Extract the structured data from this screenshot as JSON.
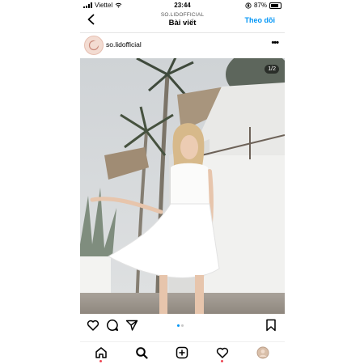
{
  "status": {
    "carrier": "Viettel",
    "time": "23:44",
    "battery": "87%"
  },
  "header": {
    "subtitle": "SO.LIDOFFICIAL",
    "title": "Bài viết",
    "follow_label": "Theo dõi"
  },
  "post": {
    "username": "so.lidofficial",
    "counter": "1/2",
    "more_label": "•••"
  },
  "pager": {
    "current": 1,
    "total": 2
  },
  "colors": {
    "accent": "#0095f6",
    "notification": "#ed4956"
  },
  "icons": [
    "chevron-left-icon",
    "heart-icon",
    "comment-icon",
    "send-icon",
    "bookmark-icon",
    "home-icon",
    "search-icon",
    "new-post-icon",
    "activity-icon",
    "profile-avatar"
  ]
}
